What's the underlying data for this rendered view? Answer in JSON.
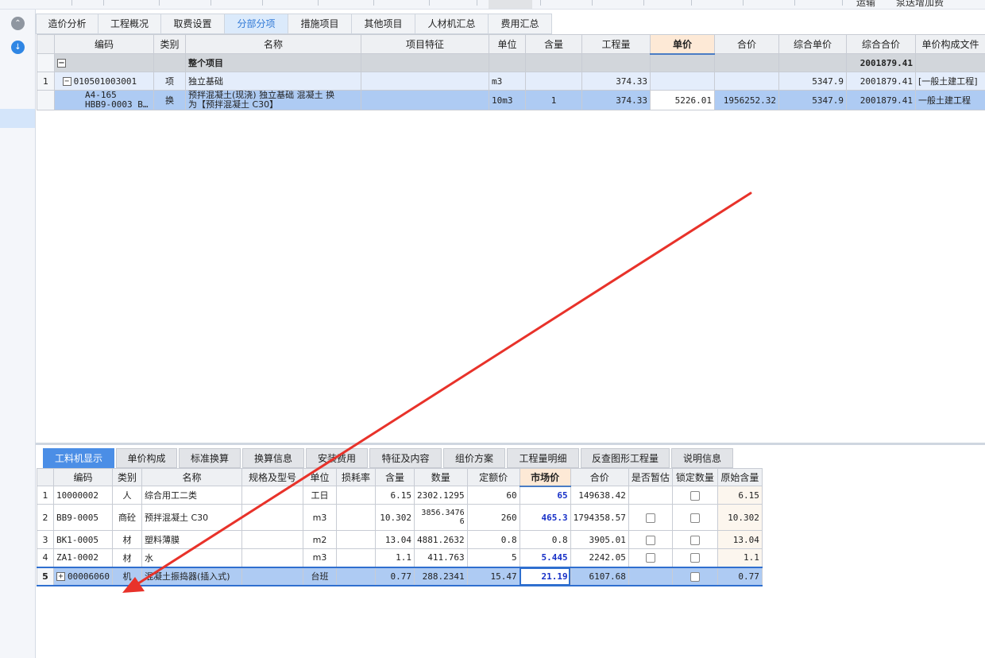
{
  "top_right": {
    "item1": "运输",
    "item2": "泵送增加费"
  },
  "tabs": [
    "造价分析",
    "工程概况",
    "取费设置",
    "分部分项",
    "措施项目",
    "其他项目",
    "人材机汇总",
    "费用汇总"
  ],
  "top_grid": {
    "columns": [
      "编码",
      "类别",
      "名称",
      "项目特征",
      "单位",
      "含量",
      "工程量",
      "单价",
      "合价",
      "综合单价",
      "综合合价",
      "单价构成文件"
    ],
    "whole": {
      "name": "整个项目",
      "total": "2001879.41"
    },
    "item": {
      "index": "1",
      "code": "010501003001",
      "type": "项",
      "name": "独立基础",
      "unit": "m3",
      "quantity": "374.33",
      "unit_price_total": "5347.9",
      "total_price": "2001879.41",
      "template": "[一般土建工程]"
    },
    "sub": {
      "code_line1": "A4-165",
      "code_line2": "HBB9-0003 B…",
      "type": "换",
      "name_line1": "预拌混凝土(现浇) 独立基础 混凝土  换",
      "name_line2": "为【预拌混凝土 C30】",
      "unit": "10m3",
      "content": "1",
      "quantity": "374.33",
      "unit_price": "5226.01",
      "price": "1956252.32",
      "unit_price_total": "5347.9",
      "total_price": "2001879.41",
      "template": "一般土建工程"
    }
  },
  "bottom_tabs": [
    "工料机显示",
    "单价构成",
    "标准换算",
    "换算信息",
    "安装费用",
    "特征及内容",
    "组价方案",
    "工程量明细",
    "反查图形工程量",
    "说明信息"
  ],
  "bottom_grid": {
    "columns": [
      "编码",
      "类别",
      "名称",
      "规格及型号",
      "单位",
      "损耗率",
      "含量",
      "数量",
      "定额价",
      "市场价",
      "合价",
      "是否暂估",
      "锁定数量",
      "原始含量"
    ],
    "rows": [
      {
        "idx": "1",
        "code": "10000002",
        "type": "人",
        "name": "综合用工二类",
        "unit": "工日",
        "content": "6.15",
        "qty": "2302.1295",
        "qty2": "",
        "quota": "60",
        "market": "65",
        "total": "149638.42",
        "orig": "6.15"
      },
      {
        "idx": "2",
        "code": "BB9-0005",
        "type": "商砼",
        "name": "预拌混凝土 C30",
        "unit": "m3",
        "content": "10.302",
        "qty": "3856.3476",
        "qty2": "6",
        "quota": "260",
        "market": "465.3",
        "total": "1794358.57",
        "orig": "10.302"
      },
      {
        "idx": "3",
        "code": "BK1-0005",
        "type": "材",
        "name": "塑料薄膜",
        "unit": "m2",
        "content": "13.04",
        "qty": "4881.2632",
        "qty2": "",
        "quota": "0.8",
        "market": "0.8",
        "total": "3905.01",
        "orig": "13.04"
      },
      {
        "idx": "4",
        "code": "ZA1-0002",
        "type": "材",
        "name": "水",
        "unit": "m3",
        "content": "1.1",
        "qty": "411.763",
        "qty2": "",
        "quota": "5",
        "market": "5.445",
        "total": "2242.05",
        "orig": "1.1"
      },
      {
        "idx": "5",
        "code": "00006060",
        "type": "机",
        "name": "混凝土振捣器(插入式)",
        "unit": "台班",
        "content": "0.77",
        "qty": "288.2341",
        "qty2": "",
        "quota": "15.47",
        "market": "21.19",
        "total": "6107.68",
        "orig": "0.77"
      }
    ]
  },
  "colors": {
    "accent": "#4b8ee6",
    "selection": "#aecbf3",
    "price_blue": "#1730c7",
    "arrow_red": "#e8322a",
    "highlight_header": "#fde9d6"
  }
}
